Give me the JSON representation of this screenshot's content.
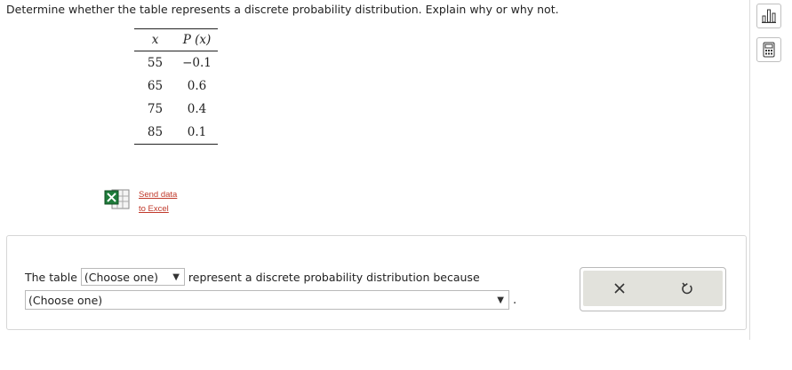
{
  "question": "Determine whether the table represents a discrete probability distribution. Explain why or why not.",
  "table": {
    "headers": [
      "x",
      "P (x)"
    ],
    "rows": [
      {
        "x": "55",
        "p": "−0.1"
      },
      {
        "x": "65",
        "p": "0.6"
      },
      {
        "x": "75",
        "p": "0.4"
      },
      {
        "x": "85",
        "p": "0.1"
      }
    ]
  },
  "excel": {
    "line1": "Send data",
    "line2": "to Excel",
    "icon": "excel-icon"
  },
  "answer": {
    "prefix": "The table",
    "select1_value": "(Choose one)",
    "middle": "represent a discrete probability distribution because",
    "select2_value": "(Choose one)",
    "suffix": "."
  },
  "tools": {
    "icons": [
      "bar-chart-icon",
      "calculator-icon"
    ]
  },
  "actions": {
    "icons": [
      "close-icon",
      "undo-icon"
    ]
  }
}
